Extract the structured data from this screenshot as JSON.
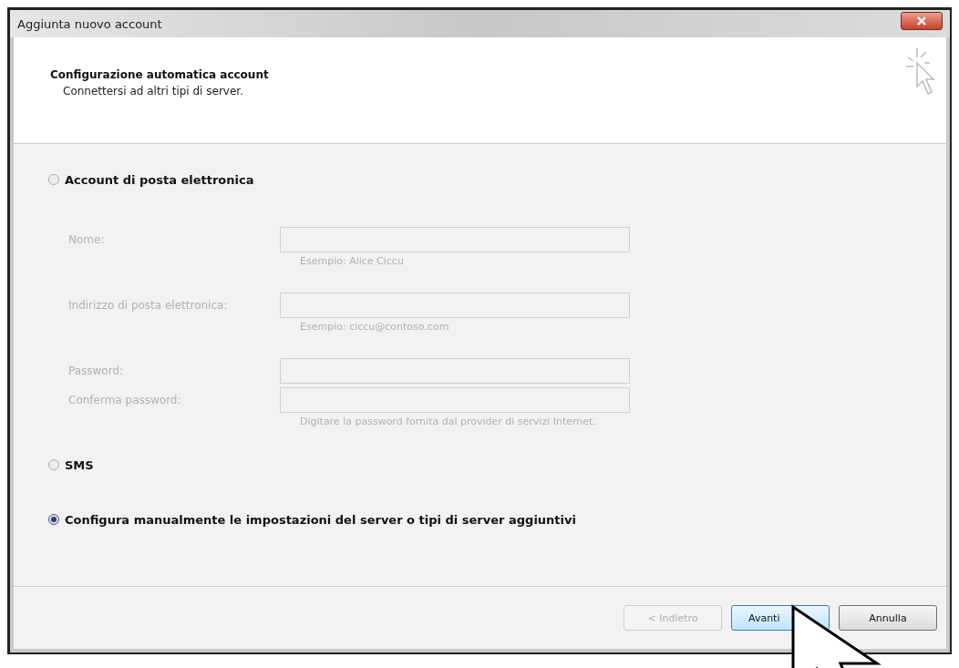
{
  "window": {
    "title": "Aggiunta nuovo account"
  },
  "header": {
    "title": "Configurazione automatica account",
    "subtitle": "Connettersi ad altri tipi di server."
  },
  "options": [
    {
      "label": "Account di posta elettronica",
      "selected": false,
      "fields": [
        {
          "label": "Nome:",
          "hint": "Esempio: Alice Ciccu",
          "disabled": true
        },
        {
          "label": "Indirizzo di posta elettronica:",
          "hint": "Esempio: ciccu@contoso.com",
          "disabled": true
        },
        {
          "label": "Password:",
          "disabled": true
        },
        {
          "label": "Conferma password:",
          "hint": "Digitare la password fornita dal provider di servizi Internet.",
          "disabled": true
        }
      ]
    },
    {
      "label": "SMS",
      "selected": false
    },
    {
      "label": "Configura manualmente le impostazioni del server o tipi di server aggiuntivi",
      "selected": true
    }
  ],
  "buttons": [
    {
      "label": "< Indietro",
      "disabled": true,
      "default": false
    },
    {
      "label": "Avanti",
      "disabled": false,
      "default": true
    },
    {
      "label": "Annulla",
      "disabled": false,
      "default": false
    }
  ]
}
